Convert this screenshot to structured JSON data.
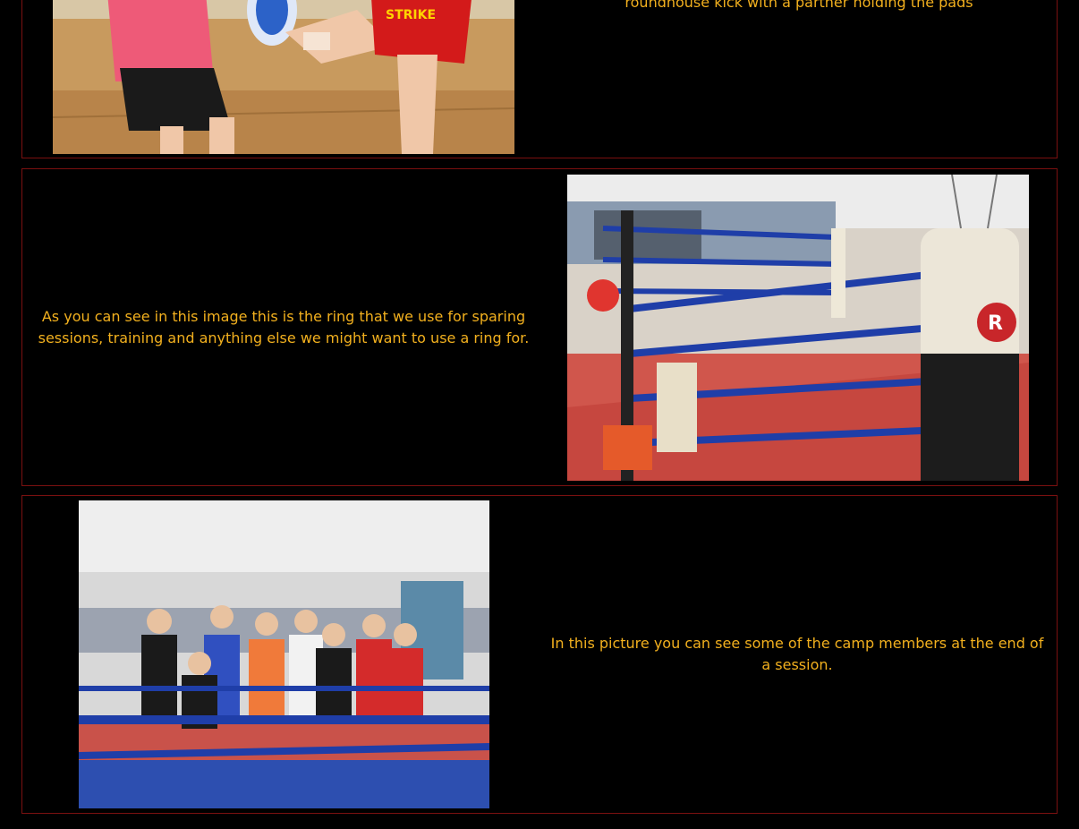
{
  "rows": [
    {
      "caption": "roundhouse kick with a partner holding the pads",
      "image_alt": "kickboxing-pad-kick-photo"
    },
    {
      "caption": "As you can see in this image this is the ring that we use for sparing sessions, training and anything else we might want to use a ring for.",
      "image_alt": "boxing-ring-photo"
    },
    {
      "caption": "In this picture you can see some of the camp members at the end of a session.",
      "image_alt": "camp-members-photo"
    }
  ],
  "colors": {
    "background": "#000000",
    "caption_text": "#f2b01e",
    "row_border": "#7a1010"
  }
}
